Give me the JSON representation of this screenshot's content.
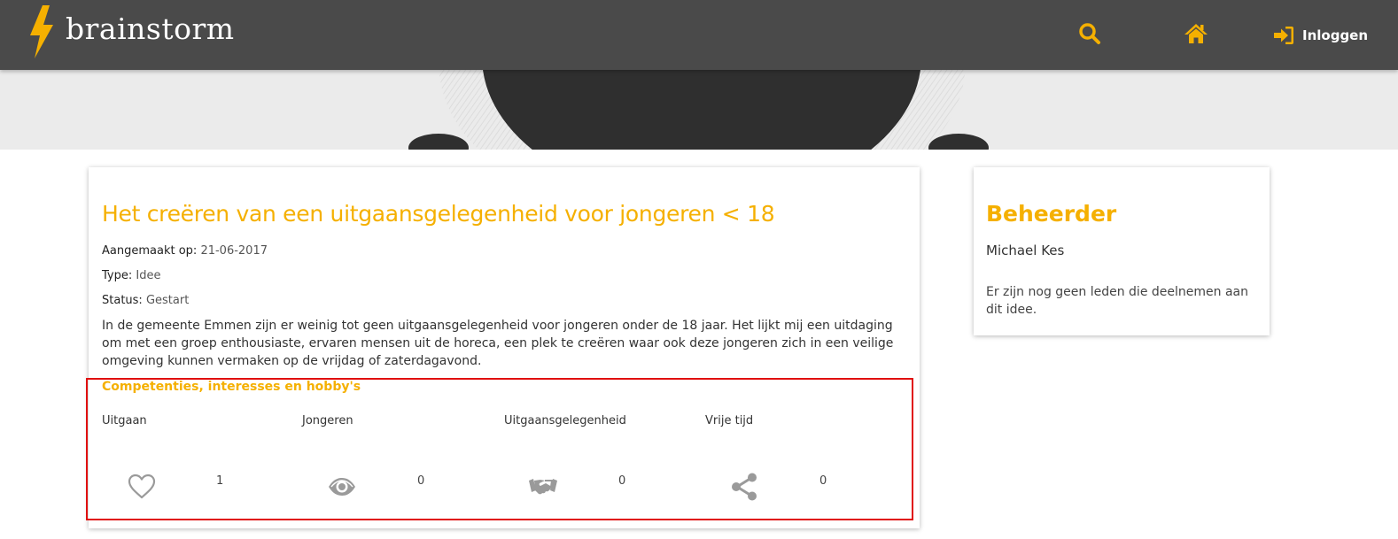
{
  "header": {
    "brand": "brainstorm",
    "login_label": "Inloggen",
    "icons": [
      "bolt-icon",
      "search-icon",
      "home-icon",
      "sign-in-icon"
    ],
    "colors": {
      "bar": "#4a4a4a",
      "accent": "#f5b000"
    }
  },
  "idea": {
    "title": "Het creëren van een uitgaansgelegenheid voor jongeren < 18",
    "created_label": "Aangemaakt op:",
    "created_value": "21-06-2017",
    "type_label": "Type:",
    "type_value": "Idee",
    "status_label": "Status:",
    "status_value": "Gestart",
    "description": "In de gemeente Emmen zijn er weinig tot geen uitgaansgelegenheid voor jongeren onder de 18 jaar. Het lijkt mij een uitdaging om met een groep enthousiaste, ervaren mensen uit de horeca, een plek te creëren waar ook deze jongeren zich in een veilige omgeving kunnen vermaken op de vrijdag of zaterdagavond.",
    "tags_title": "Competenties, interesses en hobby's",
    "tags": [
      "Uitgaan",
      "Jongeren",
      "Uitgaansgelegenheid",
      "Vrije tijd"
    ],
    "stats": [
      {
        "icon": "heart-icon",
        "value": "1"
      },
      {
        "icon": "eye-icon",
        "value": "0"
      },
      {
        "icon": "handshake-icon",
        "value": "0"
      },
      {
        "icon": "share-icon",
        "value": "0"
      }
    ]
  },
  "sidebar": {
    "title": "Beheerder",
    "name": "Michael Kes",
    "text": "Er zijn nog geen leden die deelnemen aan dit idee."
  }
}
